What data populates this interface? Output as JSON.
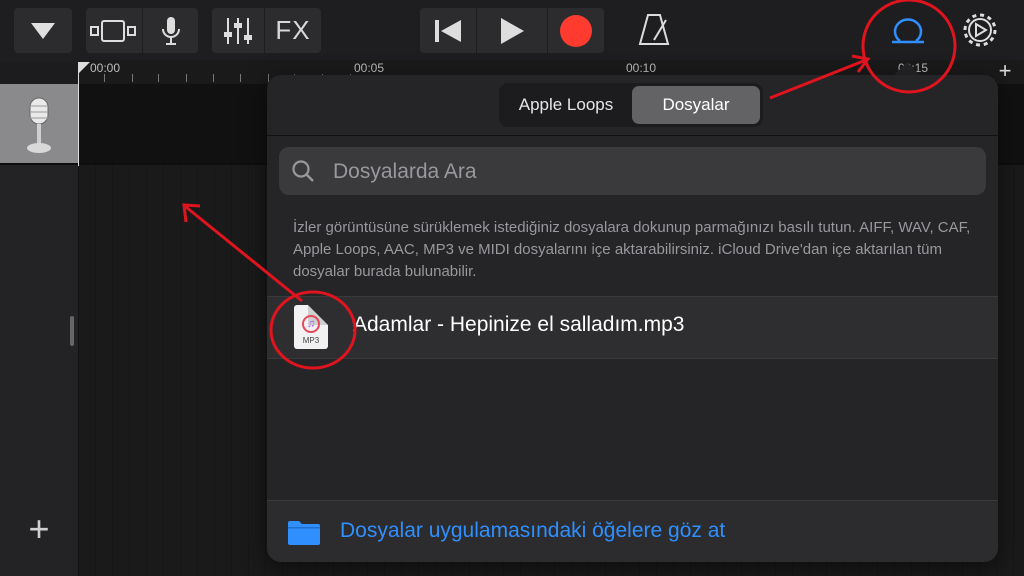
{
  "toolbar": {
    "fx_label": "FX"
  },
  "ruler": {
    "labels": [
      "00:00",
      "00:05",
      "00:10",
      "00:15"
    ]
  },
  "browser": {
    "tabs": [
      {
        "label": "Apple Loops",
        "active": false
      },
      {
        "label": "Dosyalar",
        "active": true
      }
    ],
    "search_placeholder": "Dosyalarda Ara",
    "help_text": "İzler görüntüsüne sürüklemek istediğiniz dosyalara dokunup parmağınızı basılı tutun. AIFF, WAV, CAF, Apple Loops, AAC, MP3 ve MIDI dosyalarını içe aktarabilirsiniz. iCloud Drive'dan içe aktarılan tüm dosyalar burada bulunabilir.",
    "files": [
      {
        "name": "Adamlar - Hepinize el salladım.mp3",
        "icon_label": "MP3",
        "icon": "music-file-icon"
      }
    ],
    "footer_link": "Dosyalar uygulamasındaki öğelere göz at"
  },
  "colors": {
    "accent": "#2f8fff",
    "record": "#ff3b30",
    "annotation": "#e0141e"
  }
}
